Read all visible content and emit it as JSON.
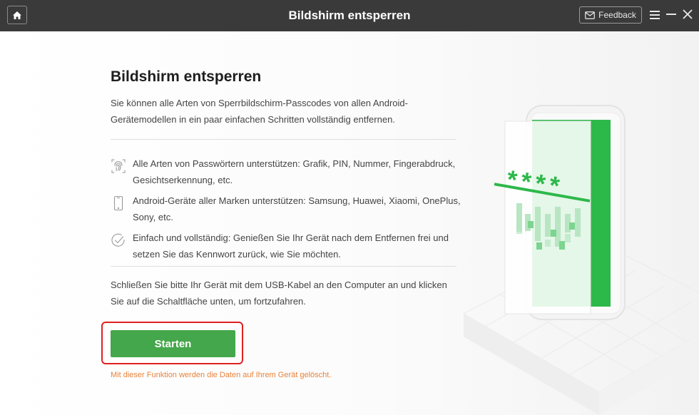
{
  "titlebar": {
    "title": "Bildshirm entsperren",
    "feedback_label": "Feedback",
    "icons": [
      "home-icon",
      "mail-icon",
      "menu-icon",
      "minimize-icon",
      "close-icon"
    ]
  },
  "main": {
    "heading": "Bildshirm entsperren",
    "intro": "Sie können alle Arten von Sperrbildschirm-Passcodes von allen Android-Gerätemodellen in ein paar einfachen Schritten vollständig entfernen.",
    "features": [
      {
        "icon": "fingerprint-icon",
        "text": "Alle Arten von Passwörtern unterstützen: Grafik, PIN, Nummer, Fingerabdruck, Gesichtserkennung, etc."
      },
      {
        "icon": "phone-icon",
        "text": "Android-Geräte aller Marken unterstützen: Samsung, Huawei, Xiaomi, OnePlus, Sony, etc."
      },
      {
        "icon": "checkmark-circle-icon",
        "text": "Einfach und vollständig: Genießen Sie Ihr Gerät nach dem Entfernen frei und setzen Sie das Kennwort zurück, wie Sie möchten."
      }
    ],
    "instruction": "Schließen Sie bitte Ihr Gerät mit dem USB-Kabel an den Computer an und klicken Sie auf die Schaltfläche unten, um fortzufahren.",
    "start_label": "Starten",
    "warning": "Mit dieser Funktion werden die Daten auf Ihrem Gerät gelöscht."
  },
  "illustration": {
    "passcode_text": "****"
  },
  "colors": {
    "titlebar": "#3a3a3a",
    "accent_green": "#45a74b",
    "illustration_green": "#2db84a",
    "warning_orange": "#e8823a",
    "highlight_red": "#e02020"
  }
}
